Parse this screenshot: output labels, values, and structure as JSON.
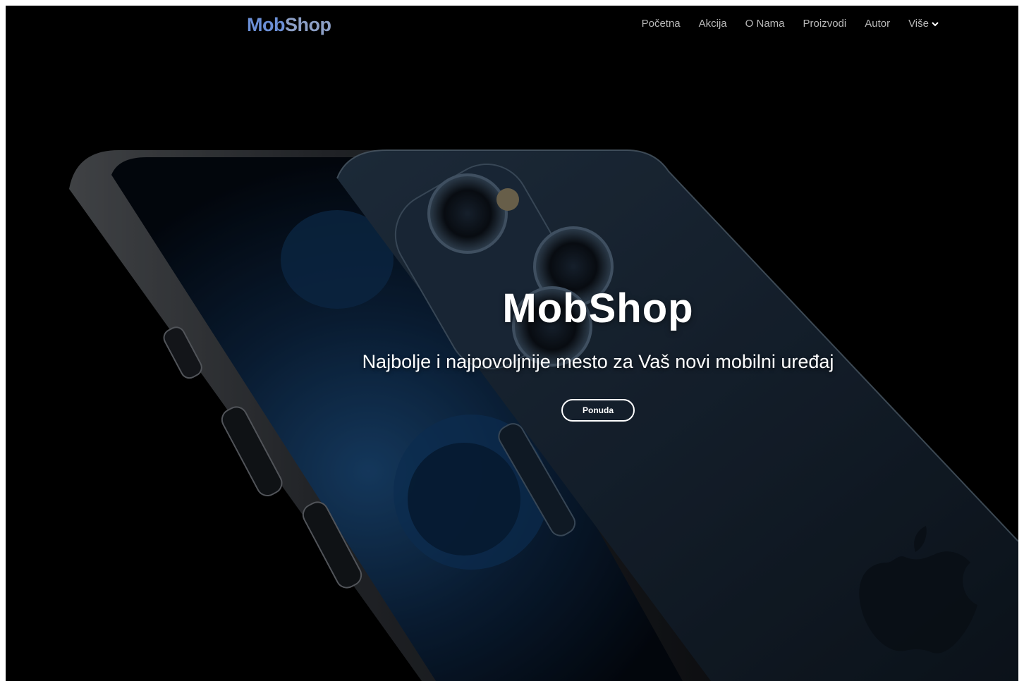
{
  "navbar": {
    "brand_part1": "Mob",
    "brand_part2": "Shop",
    "links": [
      {
        "label": "Početna"
      },
      {
        "label": "Akcija"
      },
      {
        "label": "O Nama"
      },
      {
        "label": "Proizvodi"
      },
      {
        "label": "Autor"
      },
      {
        "label": "Više",
        "icon": "chevron-down-icon"
      }
    ]
  },
  "hero": {
    "title": "MobShop",
    "subtitle": "Najbolje i najpovoljnije mesto za Vaš novi mobilni uređaj",
    "cta_label": "Ponuda"
  },
  "colors": {
    "brand_mob": "#6b8fd6",
    "brand_shop": "#8c9fc6",
    "nav_text": "#b9b9b9",
    "background": "#000000",
    "phone_blue": "#1b2a3b"
  }
}
